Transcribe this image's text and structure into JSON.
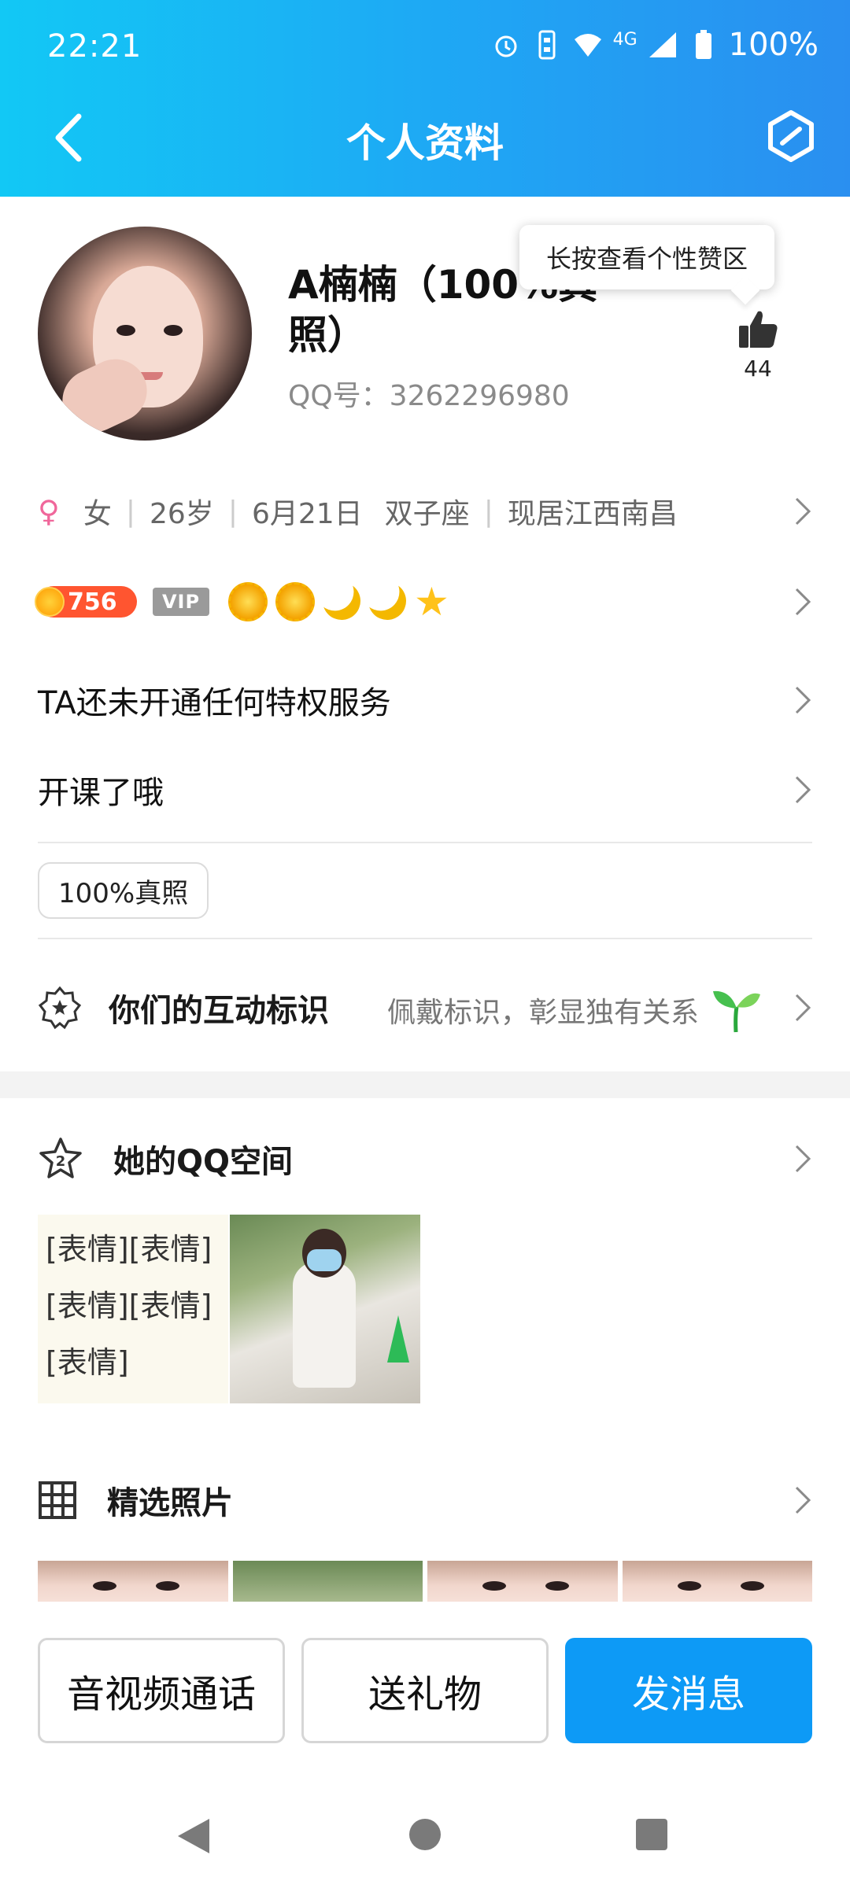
{
  "status_bar": {
    "time": "22:21",
    "network": "4G",
    "battery": "100%",
    "icons": [
      "alarm-icon",
      "vibrate-icon",
      "wifi-icon",
      "signal-icon",
      "battery-icon"
    ]
  },
  "navbar": {
    "title": "个人资料",
    "back_icon": "chevron-left-icon",
    "edit_icon": "edit-icon"
  },
  "profile": {
    "name": "A楠楠（100%真照）",
    "qq_number": "QQ号：3262296980",
    "tooltip": "长按查看个性赞区",
    "like_count": "44"
  },
  "info": {
    "gender_symbol": "♀",
    "gender": "女",
    "age": "26岁",
    "birthday": "6月21日",
    "zodiac": "双子座",
    "location": "现居江西南昌"
  },
  "level": {
    "value": "756",
    "vip": "VIP",
    "icons": [
      "sun-icon",
      "sun-icon",
      "moon-icon",
      "moon-icon",
      "star-icon"
    ]
  },
  "privilege_text": "TA还未开通任何特权服务",
  "course_text": "开课了哦",
  "tag": "100%真照",
  "interaction": {
    "title": "你们的互动标识",
    "hint": "佩戴标识，彰显独有关系"
  },
  "qzone": {
    "title": "她的QQ空间",
    "post_text": "[表情][表情][表情][表情][表情]"
  },
  "photos": {
    "title": "精选照片"
  },
  "buttons": {
    "call": "音视频通话",
    "gift": "送礼物",
    "message": "发消息"
  },
  "colors": {
    "header_gradient_start": "#12c8f5",
    "header_gradient_end": "#2a8ff0",
    "primary_button": "#0d9af6",
    "female": "#f0679b",
    "level_badge": "#ff5530"
  }
}
